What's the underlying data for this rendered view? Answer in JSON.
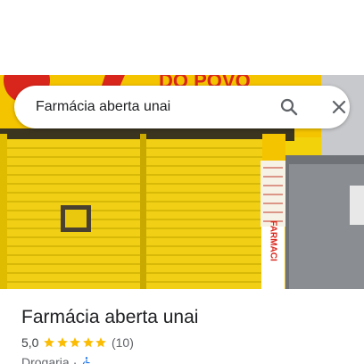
{
  "search": {
    "query": "Farmácia aberta unai"
  },
  "photo": {
    "sign_text": "DO POVO",
    "vertical_sign_text": "FARMACI",
    "colors": {
      "shutter": "#f2d20b",
      "sign": "#f5c400",
      "sign_red": "#d9261c",
      "wall": "#9aa0a6"
    }
  },
  "place": {
    "name": "Farmácia aberta unai",
    "rating": "5,0",
    "stars": 5,
    "reviews": "(10)",
    "category": "Drogaria",
    "separator": "·",
    "accessibility_icon": "wheelchair-icon"
  },
  "colors": {
    "star": "#fbbc04",
    "accessible": "#1a73e8"
  }
}
